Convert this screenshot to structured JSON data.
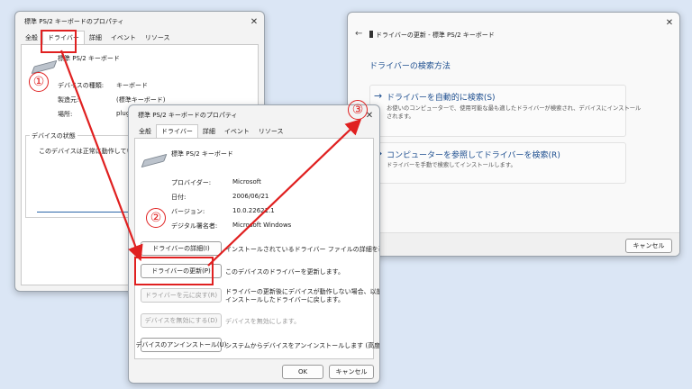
{
  "win1": {
    "title": "標準 PS/2 キーボードのプロパティ",
    "tabs": [
      "全般",
      "ドライバー",
      "詳細",
      "イベント",
      "リソース"
    ],
    "device_name": "標準 PS/2 キーボード",
    "rows": [
      {
        "label": "デバイスの種類:",
        "value": "キーボード"
      },
      {
        "label": "製造元:",
        "value": "(標準キーボード)"
      },
      {
        "label": "場所:",
        "value": "plug"
      }
    ],
    "status_title": "デバイスの状態",
    "status_text": "このデバイスは正常に動作しています。"
  },
  "win2": {
    "title": "標準 PS/2 キーボードのプロパティ",
    "tabs": [
      "全般",
      "ドライバー",
      "詳細",
      "イベント",
      "リソース"
    ],
    "device_name": "標準 PS/2 キーボード",
    "rows": [
      {
        "label": "プロバイダー:",
        "value": "Microsoft"
      },
      {
        "label": "日付:",
        "value": "2006/06/21"
      },
      {
        "label": "バージョン:",
        "value": "10.0.22621.1"
      },
      {
        "label": "デジタル署名者:",
        "value": "Microsoft Windows"
      }
    ],
    "actions": [
      {
        "button": "ドライバーの詳細(I)",
        "desc": "インストールされているドライバー ファイルの詳細を表"
      },
      {
        "button": "ドライバーの更新(P)",
        "desc": "このデバイスのドライバーを更新します。"
      },
      {
        "button": "ドライバーを元に戻す(R)",
        "desc": "ドライバーの更新後にデバイスが動作しない場合、以前に",
        "desc2": "インストールしたドライバーに戻します。"
      },
      {
        "button": "デバイスを無効にする(D)",
        "desc": "デバイスを無効にします。"
      },
      {
        "button": "デバイスのアンインストール(U)",
        "desc": "システムからデバイスをアンインストールします (高度)。"
      }
    ],
    "ok": "OK",
    "cancel": "キャンセル"
  },
  "win3": {
    "header": "ドライバーの更新 - 標準 PS/2 キーボード",
    "heading": "ドライバーの検索方法",
    "option1_title": "ドライバーを自動的に検索(S)",
    "option1_desc1": "お使いのコンピューターで、使用可能な最も適したドライバーが検索され、デバイスにインストール",
    "option1_desc2": "されます。",
    "option2_title": "コンピューターを参照してドライバーを検索(R)",
    "option2_desc": "ドライバーを手動で検索してインストールします。",
    "cancel": "キャンセル"
  },
  "steps": [
    "①",
    "②",
    "③"
  ],
  "colors": {
    "accent_red": "#e02020",
    "link_blue": "#1d4e8f",
    "background": "#dbe6f5"
  },
  "icons": [
    "close-icon",
    "keyboard-icon",
    "back-arrow-icon",
    "device-icon",
    "right-arrow-icon"
  ]
}
